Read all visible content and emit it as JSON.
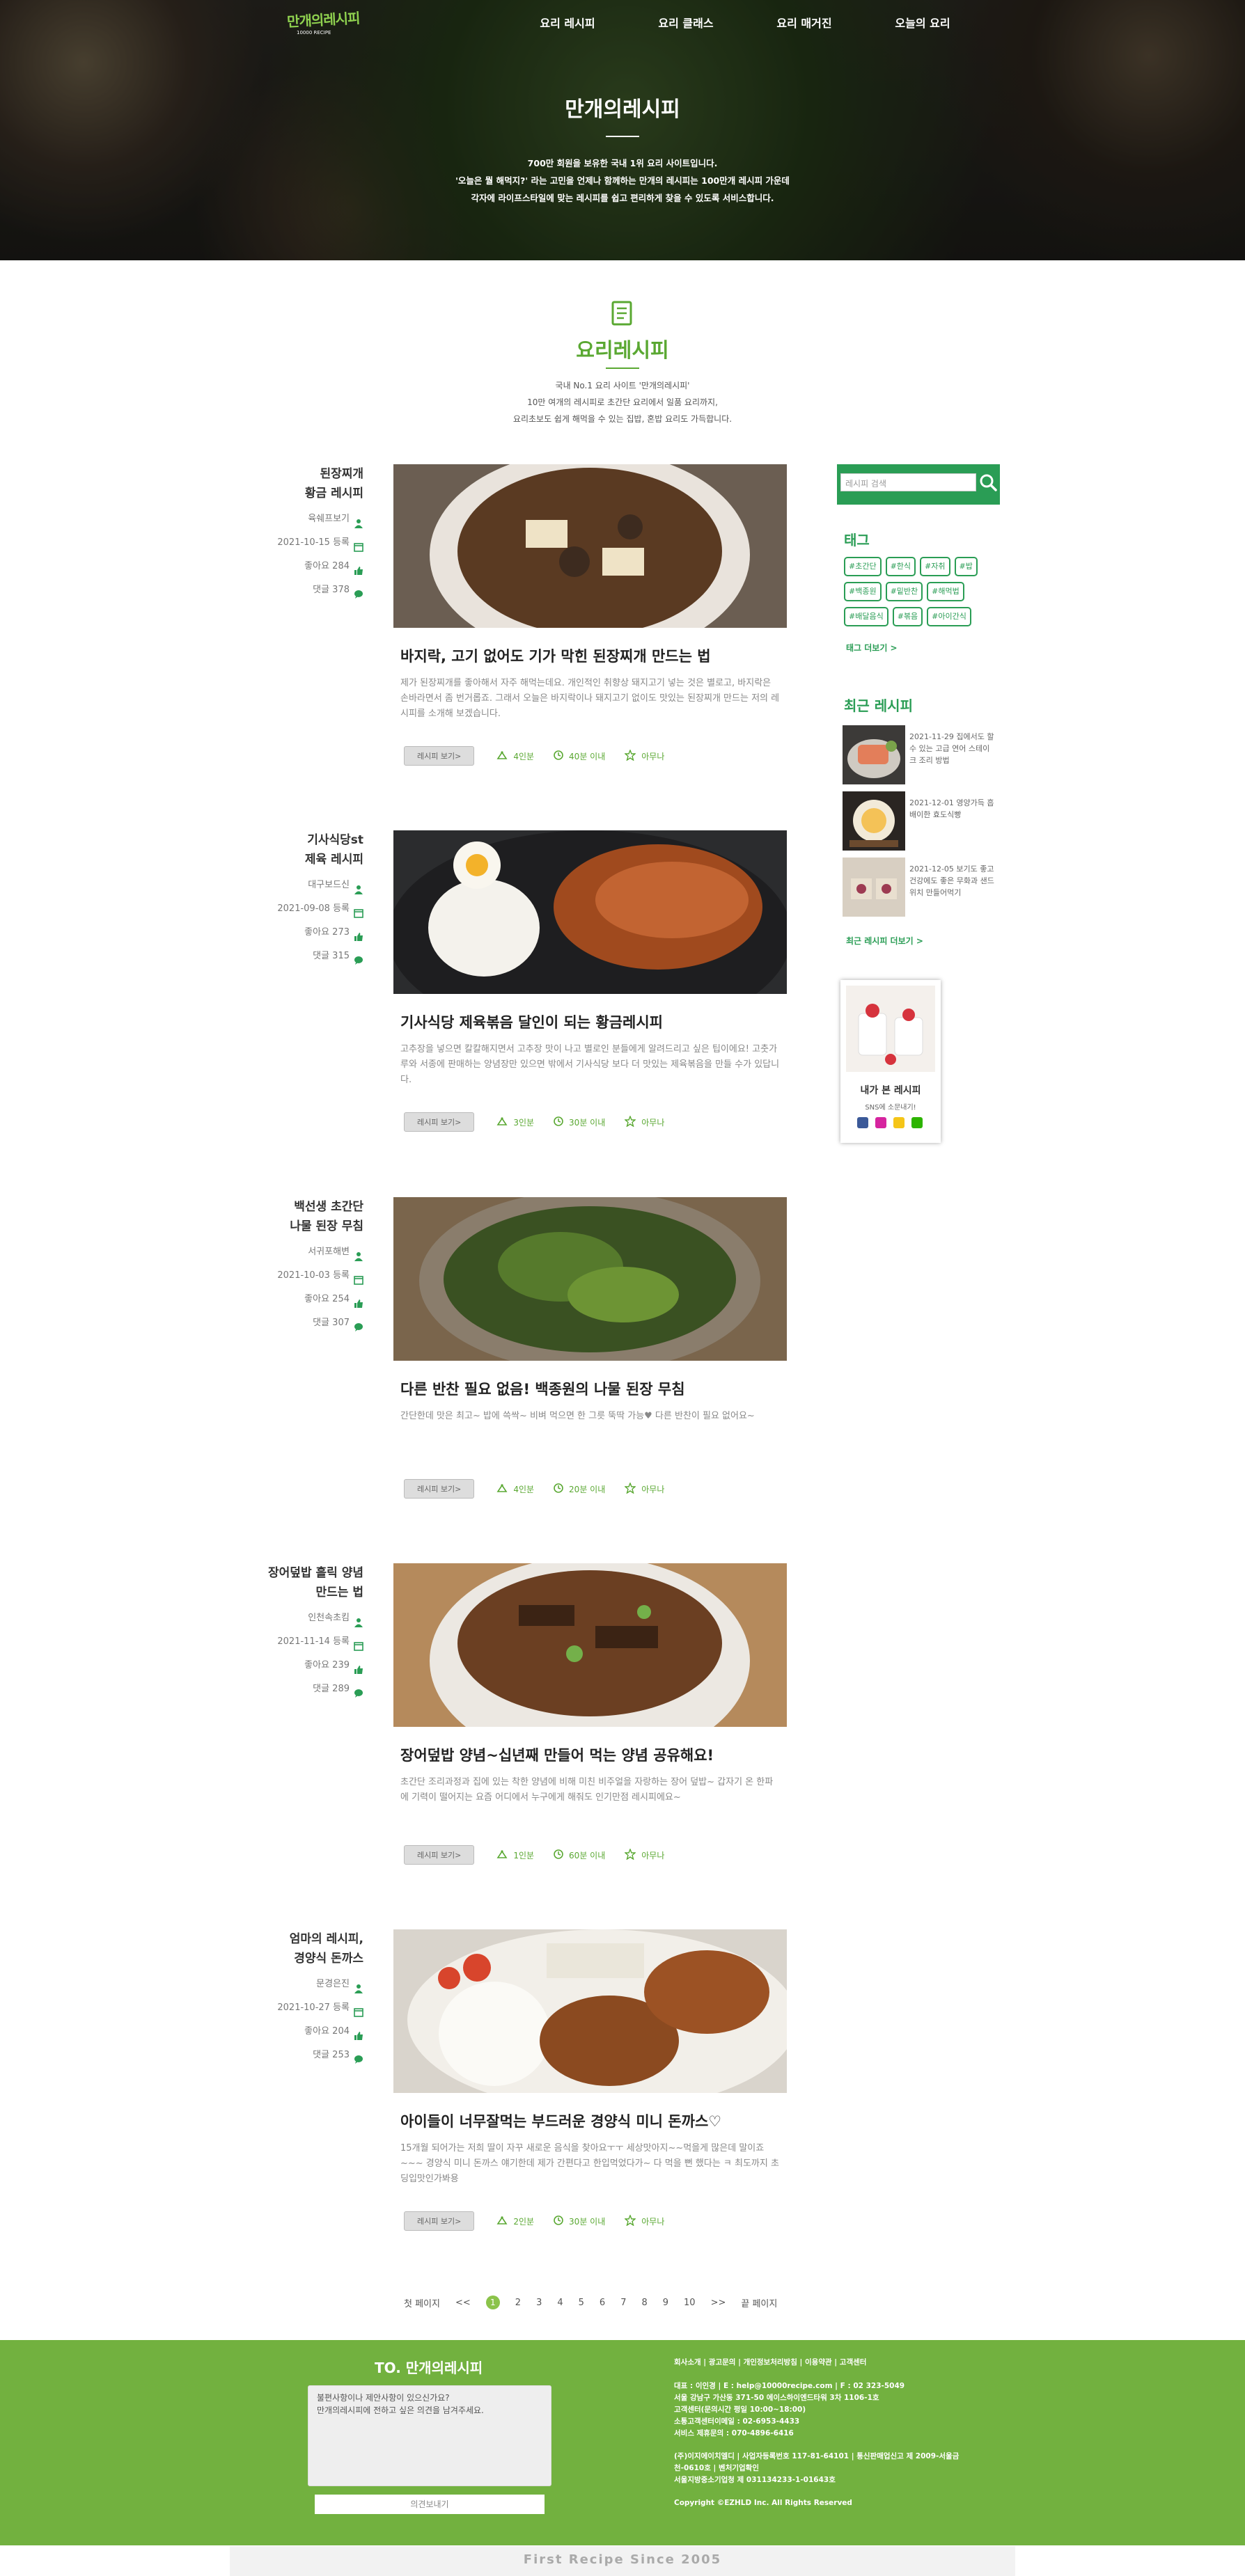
{
  "header": {
    "logo_text": "만개의레시피",
    "logo_sub": "10000 RECIPE",
    "nav": [
      "요리 레시피",
      "요리 클래스",
      "요리 매거진",
      "오늘의 요리"
    ]
  },
  "hero": {
    "title": "만개의레시피",
    "desc_lines": [
      "700만 회원을 보유한 국내 1위 요리 사이트입니다.",
      "'오늘은 뭘 해먹지?' 라는 고민을 언제나 함께하는 만개의 레시피는 100만개 레시피 가운데",
      "각자에 라이프스타일에 맞는 레시피를 쉽고 편리하게 찾을 수 있도록 서비스합니다."
    ]
  },
  "section": {
    "title": "요리레시피",
    "desc_lines": [
      "국내 No.1 요리 사이트 '만개의레시피'",
      "10만 여개의 레시피로 초간단 요리에서 일품 요리까지,",
      "요리초보도 쉽게 해먹을 수 있는 집밥, 혼밥 요리도 가득합니다."
    ]
  },
  "recipes": [
    {
      "meta_title": [
        "된장찌개",
        "황금 레시피"
      ],
      "author": "육쉐프보기",
      "date": "2021-10-15 등록",
      "likes": "좋아요 284",
      "comments": "댓글 378",
      "title": "바지락, 고기 없어도 기가 막힌 된장찌개 만드는 법",
      "desc": "제가 된장찌개를 좋아해서 자주 해먹는데요. 개인적인 취향상 돼지고기 넣는 것은 별로고, 바지락은 손바라면서 좀 번거롭죠. 그래서 오늘은 바지락이나 돼지고기 없이도 맛있는 된장찌개 만드는 저의 레시피를 소개해 보겠습니다.",
      "view": "레시피 보기>",
      "servings": "4인분",
      "time": "40분 이내",
      "level": "아무나"
    },
    {
      "meta_title": [
        "기사식당st",
        "제육 레시피"
      ],
      "author": "대구보드신",
      "date": "2021-09-08 등록",
      "likes": "좋아요 273",
      "comments": "댓글 315",
      "title": "기사식당 제육볶음 달인이 되는 황금레시피",
      "desc": "고추장을 넣으면 칼칼해지면서 고추장 맛이 나고 별로인 분들에게 알려드리고 싶은 팁이에요! 고춧가루와 서종에 판매하는 양념장만 있으면 밖에서 기사식당 보다 더 맛있는 제육볶음을 만들 수가 있답니다.",
      "view": "레시피 보기>",
      "servings": "3인분",
      "time": "30분 이내",
      "level": "아무나"
    },
    {
      "meta_title": [
        "백선생 초간단",
        "나물 된장 무침"
      ],
      "author": "서귀포해변",
      "date": "2021-10-03 등록",
      "likes": "좋아요 254",
      "comments": "댓글 307",
      "title": "다른 반찬 필요 없음! 백종원의 나물 된장 무침",
      "desc": "간단한데 맛은 최고~ 밥에 쓱싹~ 비벼 먹으면 한 그릇 뚝딱 가능♥ 다른 반찬이 필요 없어요~",
      "view": "레시피 보기>",
      "servings": "4인분",
      "time": "20분 이내",
      "level": "아무나"
    },
    {
      "meta_title": [
        "장어덮밥 흘릭 양념",
        "만드는 법"
      ],
      "author": "인천속초킴",
      "date": "2021-11-14 등록",
      "likes": "좋아요 239",
      "comments": "댓글 289",
      "title": "장어덮밥 양념~십년째 만들어 먹는 양념 공유해요!",
      "desc": "초간단 조리과정과 집에 있는 착한 양념에 비해 미친 비주얼을 자랑하는 장어 덮밥~ 갑자기 온 한파에 기력이 떨어지는 요즘 어디에서 누구에게 해줘도 인기만점 레시피에요~",
      "view": "레시피 보기>",
      "servings": "1인분",
      "time": "60분 이내",
      "level": "아무나"
    },
    {
      "meta_title": [
        "엄마의 레시피,",
        "경양식 돈까스"
      ],
      "author": "문경은진",
      "date": "2021-10-27 등록",
      "likes": "좋아요 204",
      "comments": "댓글 253",
      "title": "아이들이 너무잘먹는 부드러운 경양식 미니 돈까스♡",
      "desc": "15개월 되어가는 저희 딸이 자꾸 새로운 음식을 찾아요ㅜㅜ 세상맛아지~~먹을게 많은데 말이죠~~~ 경양식 미니 돈까스 얘기한데 제가 간편다고 한입먹었다가~ 다 먹을 뻔 했다는 ㅋ 최도까지 초딩입맛인가봐용",
      "view": "레시피 보기>",
      "servings": "2인분",
      "time": "30분 이내",
      "level": "아무나"
    }
  ],
  "sidebar": {
    "search_placeholder": "레시피 검색",
    "tags_title": "태그",
    "tags": [
      "#초간단",
      "#한식",
      "#자취",
      "#밥",
      "#백종원",
      "#밑반찬",
      "#해먹법",
      "#배달음식",
      "#볶음",
      "#아이간식"
    ],
    "tags_more": "태그 더보기 >",
    "recent_title": "최근 레시피",
    "recent": [
      {
        "text": "2021-11-29 집에서도 할 수 있는 고급 연어 스테이크 조리 방법"
      },
      {
        "text": "2021-12-01 영양가득 흡배이한 효도식빵"
      },
      {
        "text": "2021-12-05 보기도 좋고 건강에도 좋은 무화과 샌드위치 만들어먹기"
      }
    ],
    "recent_more": "최근 레시피 더보기 >",
    "my": {
      "title": "내가 본 레시피",
      "sub": "SNS에 소문내기!"
    }
  },
  "pagination": {
    "first": "첫 페이지",
    "prev": "<<",
    "pages": [
      "1",
      "2",
      "3",
      "4",
      "5",
      "6",
      "7",
      "8",
      "9",
      "10"
    ],
    "next": ">>",
    "last": "끝 페이지"
  },
  "footer": {
    "title": "TO. 만개의레시피",
    "placeholder": "불편사항이나 제안사항이 있으신가요?\n만개의레시피에 전하고 싶은 의견을 남겨주세요.",
    "send": "의견보내기",
    "links": "회사소개 | 광고문의 | 개인정보처리방침 | 이용약관 | 고객센터",
    "info": [
      "대표 : 이인경 | E : help@10000recipe.com | F : 02 323-5049\n서울 강남구 가산동 371-50 에이스하이엔드타워 3차 1106-1호\n고객센터(문의시간 평일 10:00~18:00)\n소통고객센터이메일 : 02-6953-4433\n서비스 제휴문의 : 070-4896-6416",
      "(주)이지에이치엘디 | 사업자등록번호 117-81-64101 | 통신판매업신고 제 2009-서울금천-0610호 | 벤처기업확인\n서울지방중소기업청 제 031134233-1-01643호",
      "Copyright ©EZHLD Inc. All Rights Reserved"
    ]
  },
  "bottom": {
    "text": "First Recipe Since 2005"
  },
  "colors": {
    "brand_green": "#5aa832",
    "footer_green": "#72b13f",
    "search_green": "#2a9d55"
  }
}
